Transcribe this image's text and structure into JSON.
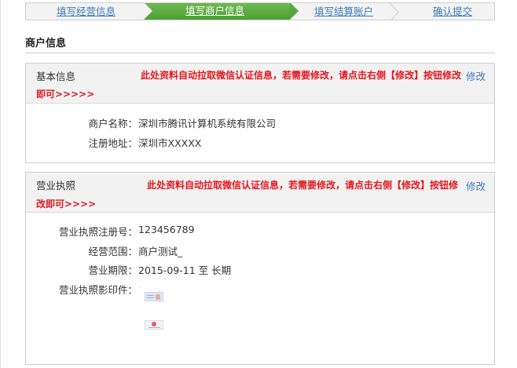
{
  "steps": [
    {
      "label": "填写经营信息",
      "active": false
    },
    {
      "label": "填写商户信息",
      "active": true
    },
    {
      "label": "填写结算账户",
      "active": false
    },
    {
      "label": "确认提交",
      "active": false
    }
  ],
  "section_title": "商户信息",
  "basic_panel": {
    "title": "基本信息",
    "notice_line1": "此处资料自动拉取微信认证信息，若需要修改，请点击右侧【修改】按钮修改",
    "notice_line2": "即可>>>>>",
    "edit_label": "修改",
    "rows": [
      {
        "label": "商户名称：",
        "value": "深圳市腾讯计算机系统有限公司"
      },
      {
        "label": "注册地址：",
        "value": "深圳市XXXXX"
      }
    ]
  },
  "license_panel": {
    "title": "营业执照",
    "notice_line1": "此处资料自动拉取微信认证信息，若需要修改，请点击右侧【修改】按钮修",
    "notice_line2": "改即可>>>>",
    "edit_label": "修改",
    "rows": [
      {
        "label": "营业执照注册号：",
        "value": "123456789"
      },
      {
        "label": "经营范围：",
        "value": "商户测试_"
      },
      {
        "label": "营业期限：",
        "value": "2015-09-11 至 长期"
      },
      {
        "label": "营业执照影印件：",
        "value": ""
      }
    ],
    "scans": [
      "id-card-front-scan-icon",
      "license-scan-icon"
    ]
  },
  "colors": {
    "active_step": "#57a83c",
    "link": "#3e7ab8",
    "notice": "#e4171f",
    "panel_header_bg": "#f2f2f2"
  }
}
